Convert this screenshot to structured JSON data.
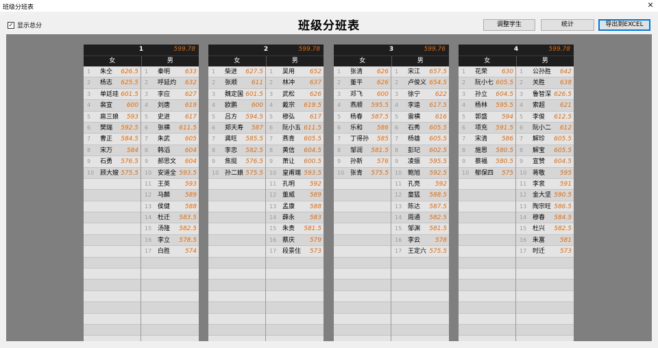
{
  "window": {
    "title": "班级分班表",
    "close_label": "✕"
  },
  "toolbar": {
    "show_total_label": "显示总分",
    "show_total_checked": true,
    "page_title": "班级分班表",
    "adjust_label": "调整学生",
    "stats_label": "统计",
    "export_label": "导出到EXCEL"
  },
  "colors": {
    "score": "#e36c0a",
    "header_bg": "#1e1e1e",
    "board_bg": "#7f7f7f"
  },
  "classes": [
    {
      "number": "1",
      "average": "599.78",
      "female_label": "女",
      "male_label": "男",
      "female": [
        {
          "no": "1",
          "name": "朱仝",
          "score": "626.5"
        },
        {
          "no": "2",
          "name": "杨志",
          "score": "625.5"
        },
        {
          "no": "3",
          "name": "单廷珪",
          "score": "601.5"
        },
        {
          "no": "4",
          "name": "裴宣",
          "score": "600"
        },
        {
          "no": "5",
          "name": "扈三娘",
          "score": "593"
        },
        {
          "no": "6",
          "name": "樊瑞",
          "score": "592.5"
        },
        {
          "no": "7",
          "name": "曹正",
          "score": "584.5"
        },
        {
          "no": "8",
          "name": "宋万",
          "score": "584"
        },
        {
          "no": "9",
          "name": "石勇",
          "score": "576.5"
        },
        {
          "no": "10",
          "name": "顾大嫂",
          "score": "575.5"
        }
      ],
      "male": [
        {
          "no": "1",
          "name": "秦明",
          "score": "633"
        },
        {
          "no": "2",
          "name": "呼延灼",
          "score": "632"
        },
        {
          "no": "3",
          "name": "李应",
          "score": "627"
        },
        {
          "no": "4",
          "name": "刘唐",
          "score": "619"
        },
        {
          "no": "5",
          "name": "史进",
          "score": "617"
        },
        {
          "no": "6",
          "name": "张横",
          "score": "611.5"
        },
        {
          "no": "7",
          "name": "朱武",
          "score": "605"
        },
        {
          "no": "8",
          "name": "韩滔",
          "score": "604"
        },
        {
          "no": "9",
          "name": "郝思文",
          "score": "604"
        },
        {
          "no": "10",
          "name": "安道全",
          "score": "593.5"
        },
        {
          "no": "11",
          "name": "王英",
          "score": "593"
        },
        {
          "no": "12",
          "name": "马麟",
          "score": "589"
        },
        {
          "no": "13",
          "name": "侯健",
          "score": "588"
        },
        {
          "no": "14",
          "name": "杜迁",
          "score": "583.5"
        },
        {
          "no": "15",
          "name": "汤隆",
          "score": "582.5"
        },
        {
          "no": "16",
          "name": "李立",
          "score": "578.5"
        },
        {
          "no": "17",
          "name": "白胜",
          "score": "574"
        }
      ]
    },
    {
      "number": "2",
      "average": "599.78",
      "female_label": "女",
      "male_label": "男",
      "female": [
        {
          "no": "1",
          "name": "柴进",
          "score": "627.5"
        },
        {
          "no": "2",
          "name": "张顺",
          "score": "611"
        },
        {
          "no": "3",
          "name": "魏定国",
          "score": "601.5"
        },
        {
          "no": "4",
          "name": "欧鹏",
          "score": "600"
        },
        {
          "no": "5",
          "name": "吕方",
          "score": "594.5"
        },
        {
          "no": "6",
          "name": "郑天寿",
          "score": "587"
        },
        {
          "no": "7",
          "name": "龚旺",
          "score": "585.5"
        },
        {
          "no": "8",
          "name": "李忠",
          "score": "582.5"
        },
        {
          "no": "9",
          "name": "焦挺",
          "score": "576.5"
        },
        {
          "no": "10",
          "name": "孙二娘",
          "score": "575.5"
        }
      ],
      "male": [
        {
          "no": "1",
          "name": "吴用",
          "score": "652"
        },
        {
          "no": "2",
          "name": "林冲",
          "score": "637"
        },
        {
          "no": "3",
          "name": "武松",
          "score": "626"
        },
        {
          "no": "4",
          "name": "戴宗",
          "score": "619.5"
        },
        {
          "no": "5",
          "name": "穆弘",
          "score": "617"
        },
        {
          "no": "6",
          "name": "阮小五",
          "score": "611.5"
        },
        {
          "no": "7",
          "name": "燕青",
          "score": "605.5"
        },
        {
          "no": "8",
          "name": "黄信",
          "score": "604.5"
        },
        {
          "no": "9",
          "name": "萧让",
          "score": "600.5"
        },
        {
          "no": "10",
          "name": "皇甫端",
          "score": "593.5"
        },
        {
          "no": "11",
          "name": "孔明",
          "score": "592"
        },
        {
          "no": "12",
          "name": "董威",
          "score": "589"
        },
        {
          "no": "13",
          "name": "孟康",
          "score": "588"
        },
        {
          "no": "14",
          "name": "薛永",
          "score": "583"
        },
        {
          "no": "15",
          "name": "朱贵",
          "score": "581.5"
        },
        {
          "no": "16",
          "name": "蔡庆",
          "score": "579"
        },
        {
          "no": "17",
          "name": "段景住",
          "score": "573"
        }
      ]
    },
    {
      "number": "3",
      "average": "599.76",
      "female_label": "女",
      "male_label": "男",
      "female": [
        {
          "no": "1",
          "name": "张清",
          "score": "626"
        },
        {
          "no": "2",
          "name": "董平",
          "score": "626"
        },
        {
          "no": "3",
          "name": "邓飞",
          "score": "600"
        },
        {
          "no": "4",
          "name": "燕顺",
          "score": "595.5"
        },
        {
          "no": "5",
          "name": "杨春",
          "score": "587.5"
        },
        {
          "no": "6",
          "name": "乐和",
          "score": "586"
        },
        {
          "no": "7",
          "name": "丁得孙",
          "score": "585"
        },
        {
          "no": "8",
          "name": "邹润",
          "score": "581.5"
        },
        {
          "no": "9",
          "name": "孙新",
          "score": "576"
        },
        {
          "no": "10",
          "name": "张青",
          "score": "575.5"
        }
      ],
      "male": [
        {
          "no": "1",
          "name": "宋江",
          "score": "657.5"
        },
        {
          "no": "2",
          "name": "卢俊义",
          "score": "654.5"
        },
        {
          "no": "3",
          "name": "徐宁",
          "score": "622"
        },
        {
          "no": "4",
          "name": "李逵",
          "score": "617.5"
        },
        {
          "no": "5",
          "name": "雷横",
          "score": "616"
        },
        {
          "no": "6",
          "name": "石秀",
          "score": "605.5"
        },
        {
          "no": "7",
          "name": "杨雄",
          "score": "605.5"
        },
        {
          "no": "8",
          "name": "彭玘",
          "score": "602.5"
        },
        {
          "no": "9",
          "name": "凌振",
          "score": "595.5"
        },
        {
          "no": "10",
          "name": "鲍旭",
          "score": "592.5"
        },
        {
          "no": "11",
          "name": "孔亮",
          "score": "592"
        },
        {
          "no": "12",
          "name": "童猛",
          "score": "588.5"
        },
        {
          "no": "13",
          "name": "陈达",
          "score": "587.5"
        },
        {
          "no": "14",
          "name": "周通",
          "score": "582.5"
        },
        {
          "no": "15",
          "name": "邹渊",
          "score": "581.5"
        },
        {
          "no": "16",
          "name": "李云",
          "score": "578"
        },
        {
          "no": "17",
          "name": "王定六",
          "score": "575.5"
        }
      ]
    },
    {
      "number": "4",
      "average": "599.78",
      "female_label": "女",
      "male_label": "男",
      "female": [
        {
          "no": "1",
          "name": "花荣",
          "score": "630"
        },
        {
          "no": "2",
          "name": "阮小七",
          "score": "605.5"
        },
        {
          "no": "3",
          "name": "孙立",
          "score": "604.5"
        },
        {
          "no": "4",
          "name": "杨林",
          "score": "595.5"
        },
        {
          "no": "5",
          "name": "郭盛",
          "score": "594"
        },
        {
          "no": "6",
          "name": "项充",
          "score": "591.5"
        },
        {
          "no": "7",
          "name": "宋清",
          "score": "586"
        },
        {
          "no": "8",
          "name": "施恩",
          "score": "580.5"
        },
        {
          "no": "9",
          "name": "蔡福",
          "score": "580.5"
        },
        {
          "no": "10",
          "name": "郁保四",
          "score": "575"
        }
      ],
      "male": [
        {
          "no": "1",
          "name": "公孙胜",
          "score": "642"
        },
        {
          "no": "2",
          "name": "关胜",
          "score": "638"
        },
        {
          "no": "3",
          "name": "鲁智深",
          "score": "626.5"
        },
        {
          "no": "4",
          "name": "索超",
          "score": "621"
        },
        {
          "no": "5",
          "name": "李俊",
          "score": "612.5"
        },
        {
          "no": "6",
          "name": "阮小二",
          "score": "612"
        },
        {
          "no": "7",
          "name": "解珍",
          "score": "605.5"
        },
        {
          "no": "8",
          "name": "解宝",
          "score": "605.5"
        },
        {
          "no": "9",
          "name": "宣赞",
          "score": "604.5"
        },
        {
          "no": "10",
          "name": "蒋敬",
          "score": "595"
        },
        {
          "no": "11",
          "name": "李衮",
          "score": "591"
        },
        {
          "no": "12",
          "name": "金大坚",
          "score": "590.5"
        },
        {
          "no": "13",
          "name": "陶宗旺",
          "score": "586.5"
        },
        {
          "no": "14",
          "name": "穆春",
          "score": "584.5"
        },
        {
          "no": "15",
          "name": "杜兴",
          "score": "582.5"
        },
        {
          "no": "16",
          "name": "朱富",
          "score": "581"
        },
        {
          "no": "17",
          "name": "时迁",
          "score": "573"
        }
      ]
    }
  ]
}
